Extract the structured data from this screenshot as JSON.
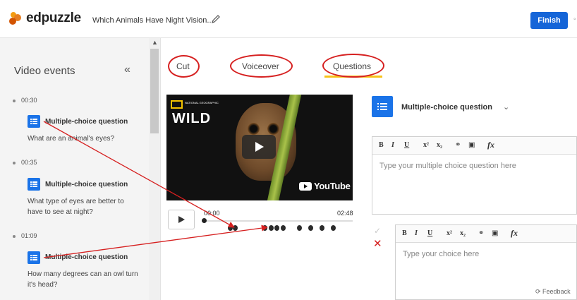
{
  "app": {
    "logo_text": "edpuzzle",
    "video_title": "Which Animals Have Night Vision...",
    "finish_label": "Finish",
    "accent": "#1565d8"
  },
  "sidebar": {
    "title": "Video events",
    "events": [
      {
        "time": "00:30",
        "type": "Multiple-choice question",
        "text": "What are an animal's eyes?"
      },
      {
        "time": "00:35",
        "type": "Multiple-choice question",
        "text": "What type of eyes are better to have to see at night?"
      },
      {
        "time": "01:09",
        "type": "Multiple-choice question",
        "text": "How many degrees can an owl turn it's head?"
      }
    ]
  },
  "tabs": {
    "cut": "Cut",
    "voiceover": "Voiceover",
    "questions": "Questions",
    "active": "Questions"
  },
  "video": {
    "brand": "NATIONAL GEOGRAPHIC",
    "show": "WILD",
    "platform": "YouTube",
    "current_time": "00:00",
    "duration": "02:48"
  },
  "question_panel": {
    "type_label": "Multiple-choice question",
    "question_placeholder": "Type your multiple choice question here",
    "choice_placeholder": "Type your choice here",
    "toolbar": [
      "B",
      "I",
      "U",
      "x²",
      "x₂",
      "link",
      "image",
      "fx"
    ]
  },
  "footer": {
    "feedback": "Feedback"
  },
  "annotation_color": "#d62020"
}
